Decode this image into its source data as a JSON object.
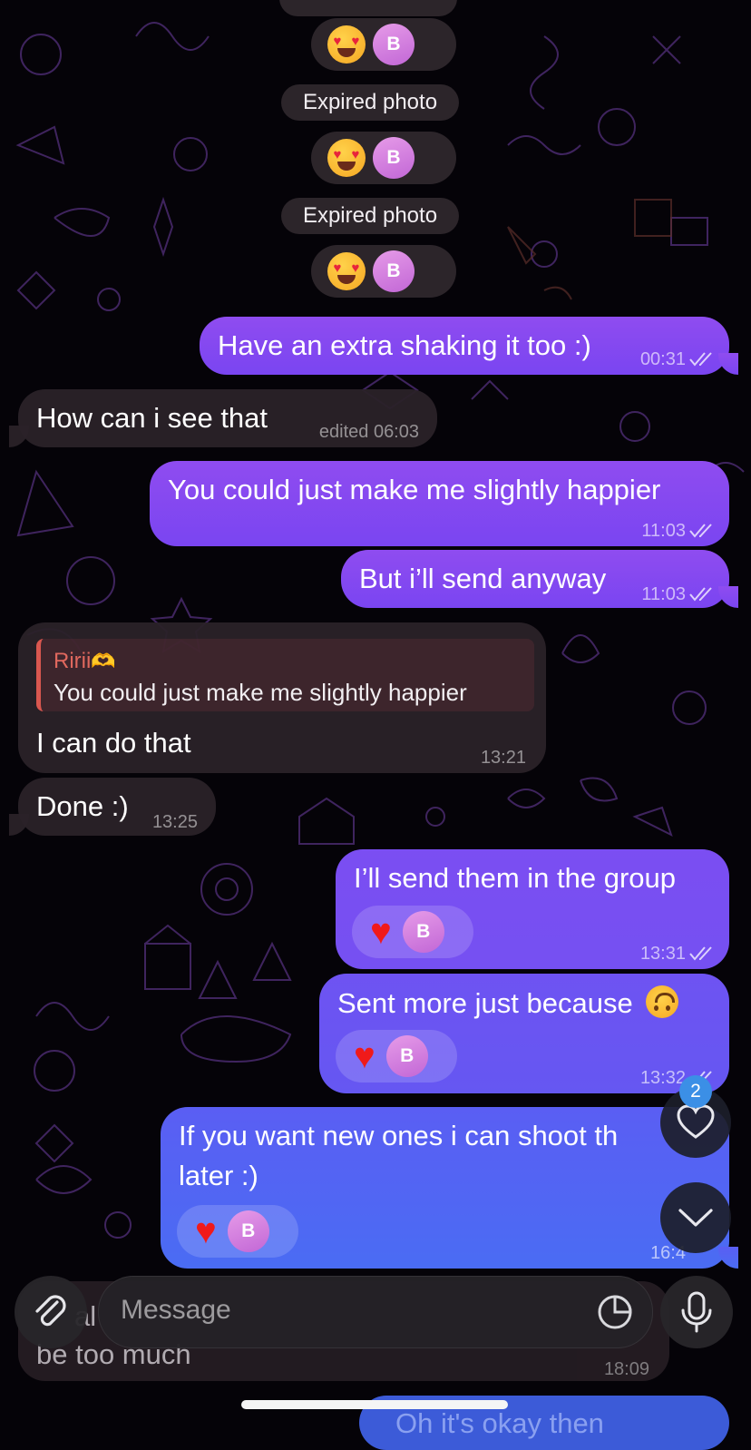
{
  "system": {
    "expired_photo_1": "Expired photo",
    "expired_photo_2": "Expired photo",
    "reaction_emoji_name": "heart-eyes-emoji",
    "reactor_initial": "B"
  },
  "messages": {
    "m1": {
      "text": "Have an extra shaking it too :)",
      "time": "00:31"
    },
    "m2": {
      "text": "How can i see that",
      "time": "edited 06:03"
    },
    "m3": {
      "text": "You could just make me slightly happier",
      "time": "11:03"
    },
    "m4": {
      "text": "But i’ll send anyway",
      "time": "11:03"
    },
    "m5": {
      "reply_name": "Ririi",
      "reply_emoji_name": "heart-hands-emoji",
      "reply_text": "You could just make me slightly happier",
      "text": "I can do that",
      "time": "13:21"
    },
    "m6": {
      "text": "Done :)",
      "time": "13:25"
    },
    "m7": {
      "text": "I’ll send them in the group",
      "time": "13:31",
      "reactor_initial": "B"
    },
    "m8": {
      "text": "Sent more just because",
      "emoji_name": "upside-down-face-emoji",
      "time": "13:32",
      "reactor_initial": "B"
    },
    "m9": {
      "line1": "If you want new ones i can shoot th",
      "line2": "later :)",
      "time": "16:4",
      "reactor_initial": "B"
    }
  },
  "behind": {
    "incoming_line1": "al",
    "incoming_line2": "be too much",
    "incoming_time": "18:09",
    "outgoing_text": "Oh it's okay then"
  },
  "floating": {
    "reactions_badge_count": "2"
  },
  "composer": {
    "placeholder": "Message"
  },
  "colors": {
    "outgoing_top": "#8f4cf0",
    "outgoing_bottom": "#4a6cf3",
    "incoming": "#2a2228",
    "reply_accent": "#d9574f",
    "badge": "#3b8fe6",
    "heart": "#f01a1a"
  }
}
